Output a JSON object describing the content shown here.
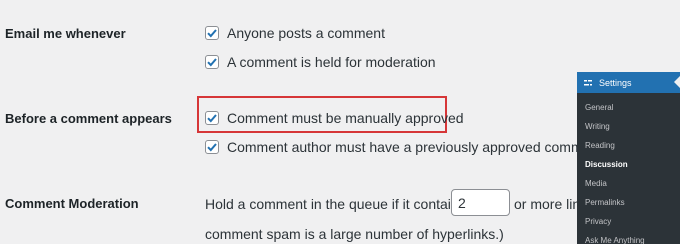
{
  "settings": {
    "email": {
      "label": "Email me whenever",
      "options": [
        {
          "label": "Anyone posts a comment",
          "checked": true
        },
        {
          "label": "A comment is held for moderation",
          "checked": true
        }
      ]
    },
    "before": {
      "label": "Before a comment appears",
      "options": [
        {
          "label": "Comment must be manually approved",
          "checked": true,
          "highlighted": true
        },
        {
          "label": "Comment author must have a previously approved comment",
          "checked": true
        }
      ]
    },
    "moderation": {
      "label": "Comment Moderation",
      "text1": "Hold a comment in the queue if it contains",
      "links_value": "2",
      "text1_after": "or more lin",
      "text2": "comment spam is a large number of hyperlinks.)"
    }
  },
  "submenu": {
    "title": "Settings",
    "items": [
      "General",
      "Writing",
      "Reading",
      "Discussion",
      "Media",
      "Permalinks",
      "Privacy",
      "Ask Me Anything"
    ],
    "current": "Discussion"
  },
  "colors": {
    "highlight_border": "#d63638",
    "menu_bg": "#2c3338",
    "menu_active_bg": "#2271b1",
    "checkmark": "#2271b1"
  }
}
